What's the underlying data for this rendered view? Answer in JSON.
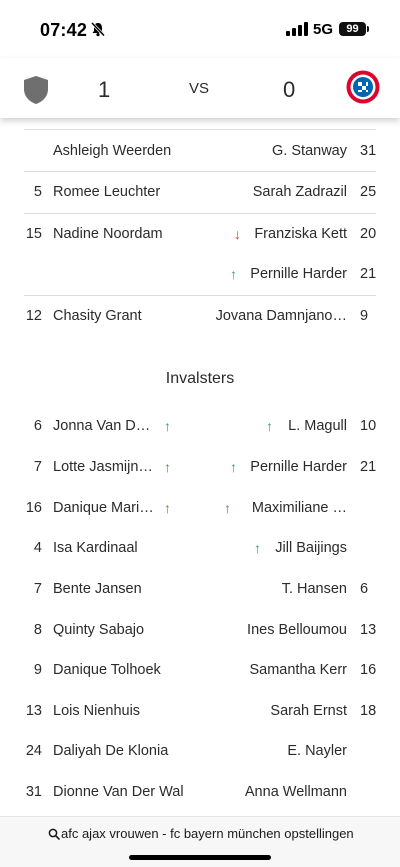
{
  "status_bar": {
    "time": "07:42",
    "network": "5G",
    "battery": "99"
  },
  "score": {
    "home": "1",
    "vs": "VS",
    "away": "0"
  },
  "starters": [
    {
      "home_num": "",
      "home_name": "Ashleigh Weerden",
      "away_name": "G. Stanway",
      "away_num": "31"
    },
    {
      "home_num": "5",
      "home_name": "Romee Leuchter",
      "away_name": "Sarah Zadrazil",
      "away_num": "25"
    },
    {
      "home_num": "15",
      "home_name": "Nadine Noordam",
      "away_name": "Franziska Kett",
      "away_num": "20",
      "away_arrow": "down"
    },
    {
      "home_num": "",
      "home_name": "",
      "away_name": "Pernille Harder",
      "away_num": "21",
      "away_arrow": "up"
    },
    {
      "home_num": "12",
      "home_name": "Chasity Grant",
      "away_name": "Jovana Damnjano…",
      "away_num": "9"
    }
  ],
  "subs_title": "Invalsters",
  "subs": [
    {
      "home_num": "6",
      "home_name": "Jonna Van D…",
      "home_arrow": "up",
      "away_name": "L. Magull",
      "away_num": "10",
      "away_arrow": "up"
    },
    {
      "home_num": "7",
      "home_name": "Lotte Jasmijn…",
      "home_arrow": "up",
      "away_name": "Pernille Harder",
      "away_num": "21",
      "away_arrow": "up"
    },
    {
      "home_num": "16",
      "home_name": "Danique Mari…",
      "home_arrow": "up",
      "away_name": "Maximiliane …",
      "away_num": "",
      "away_arrow": "up"
    },
    {
      "home_num": "4",
      "home_name": "Isa Kardinaal",
      "away_name": "Jill Baijings",
      "away_num": "",
      "away_arrow": "up"
    },
    {
      "home_num": "7",
      "home_name": "Bente Jansen",
      "away_name": "T. Hansen",
      "away_num": "6"
    },
    {
      "home_num": "8",
      "home_name": "Quinty Sabajo",
      "away_name": "Ines Belloumou",
      "away_num": "13"
    },
    {
      "home_num": "9",
      "home_name": "Danique Tolhoek",
      "away_name": "Samantha Kerr",
      "away_num": "16"
    },
    {
      "home_num": "13",
      "home_name": "Lois Nienhuis",
      "away_name": "Sarah Ernst",
      "away_num": "18"
    },
    {
      "home_num": "24",
      "home_name": "Daliyah De Klonia",
      "away_name": "E. Nayler",
      "away_num": ""
    },
    {
      "home_num": "31",
      "home_name": "Dionne Van Der Wal",
      "away_name": "Anna Wellmann",
      "away_num": ""
    }
  ],
  "search": {
    "query": "afc ajax vrouwen - fc bayern münchen opstellingen"
  },
  "colors": {
    "arrow_up": "#2ea84a",
    "arrow_down": "#d83a3a",
    "home_crest": "#6f6f6f",
    "away_crest": "#dc052d"
  }
}
